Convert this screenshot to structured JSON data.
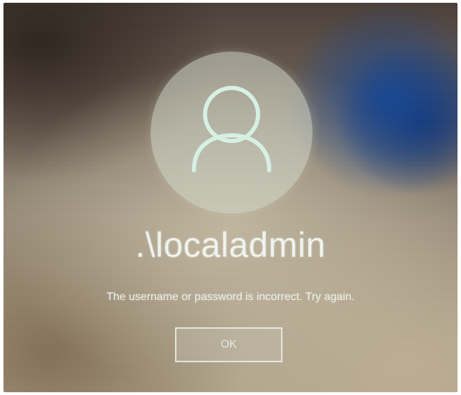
{
  "login": {
    "avatar_icon": "user-icon",
    "username": ".\\localadmin",
    "message": "The username or password is incorrect. Try again.",
    "ok_label": "OK"
  },
  "colors": {
    "text": "#f2f6f0",
    "avatar_outline": "#d8f3e6",
    "accent_blue": "#1b4a9a"
  }
}
